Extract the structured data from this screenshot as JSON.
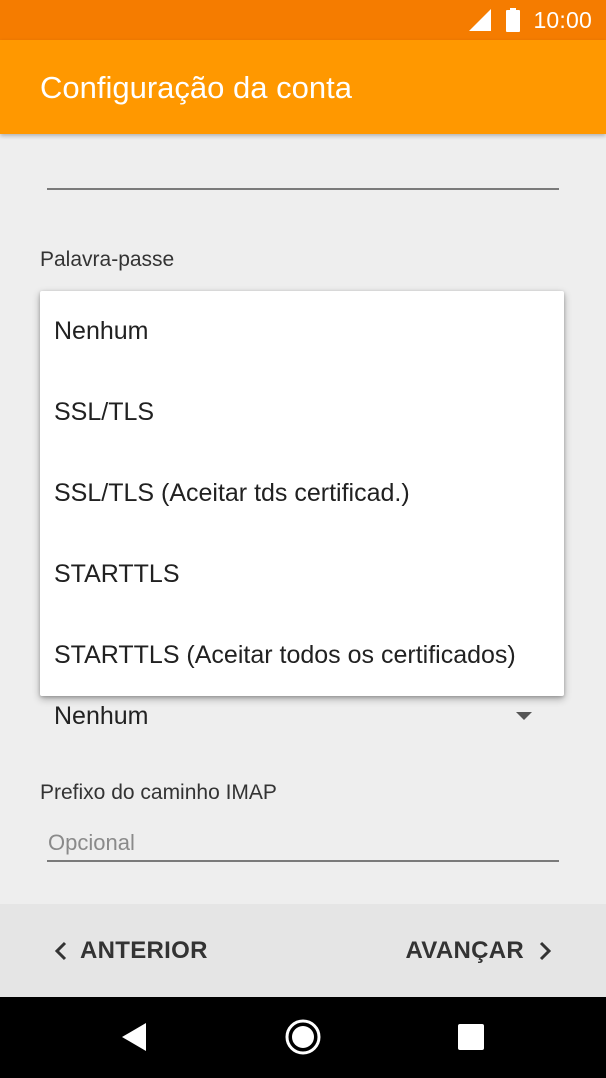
{
  "status_bar": {
    "time": "10:00",
    "icons": [
      "signal-icon",
      "battery-icon"
    ],
    "background": "#f57c00"
  },
  "app_bar": {
    "title": "Configuração da conta",
    "background": "#ff9800"
  },
  "form": {
    "password_label": "Palavra-passe",
    "security_type_value": "Nenhum",
    "imap_prefix_label": "Prefixo do caminho IMAP",
    "imap_prefix_placeholder": "Opcional"
  },
  "dropdown": {
    "options": [
      "Nenhum",
      "SSL/TLS",
      "SSL/TLS (Aceitar tds certificad.)",
      "STARTTLS",
      "STARTTLS (Aceitar todos os certificados)"
    ]
  },
  "bottom_bar": {
    "prev_label": "ANTERIOR",
    "next_label": "AVANÇAR"
  },
  "system_nav": {
    "icons": [
      "back-icon",
      "home-icon",
      "recents-icon"
    ]
  }
}
